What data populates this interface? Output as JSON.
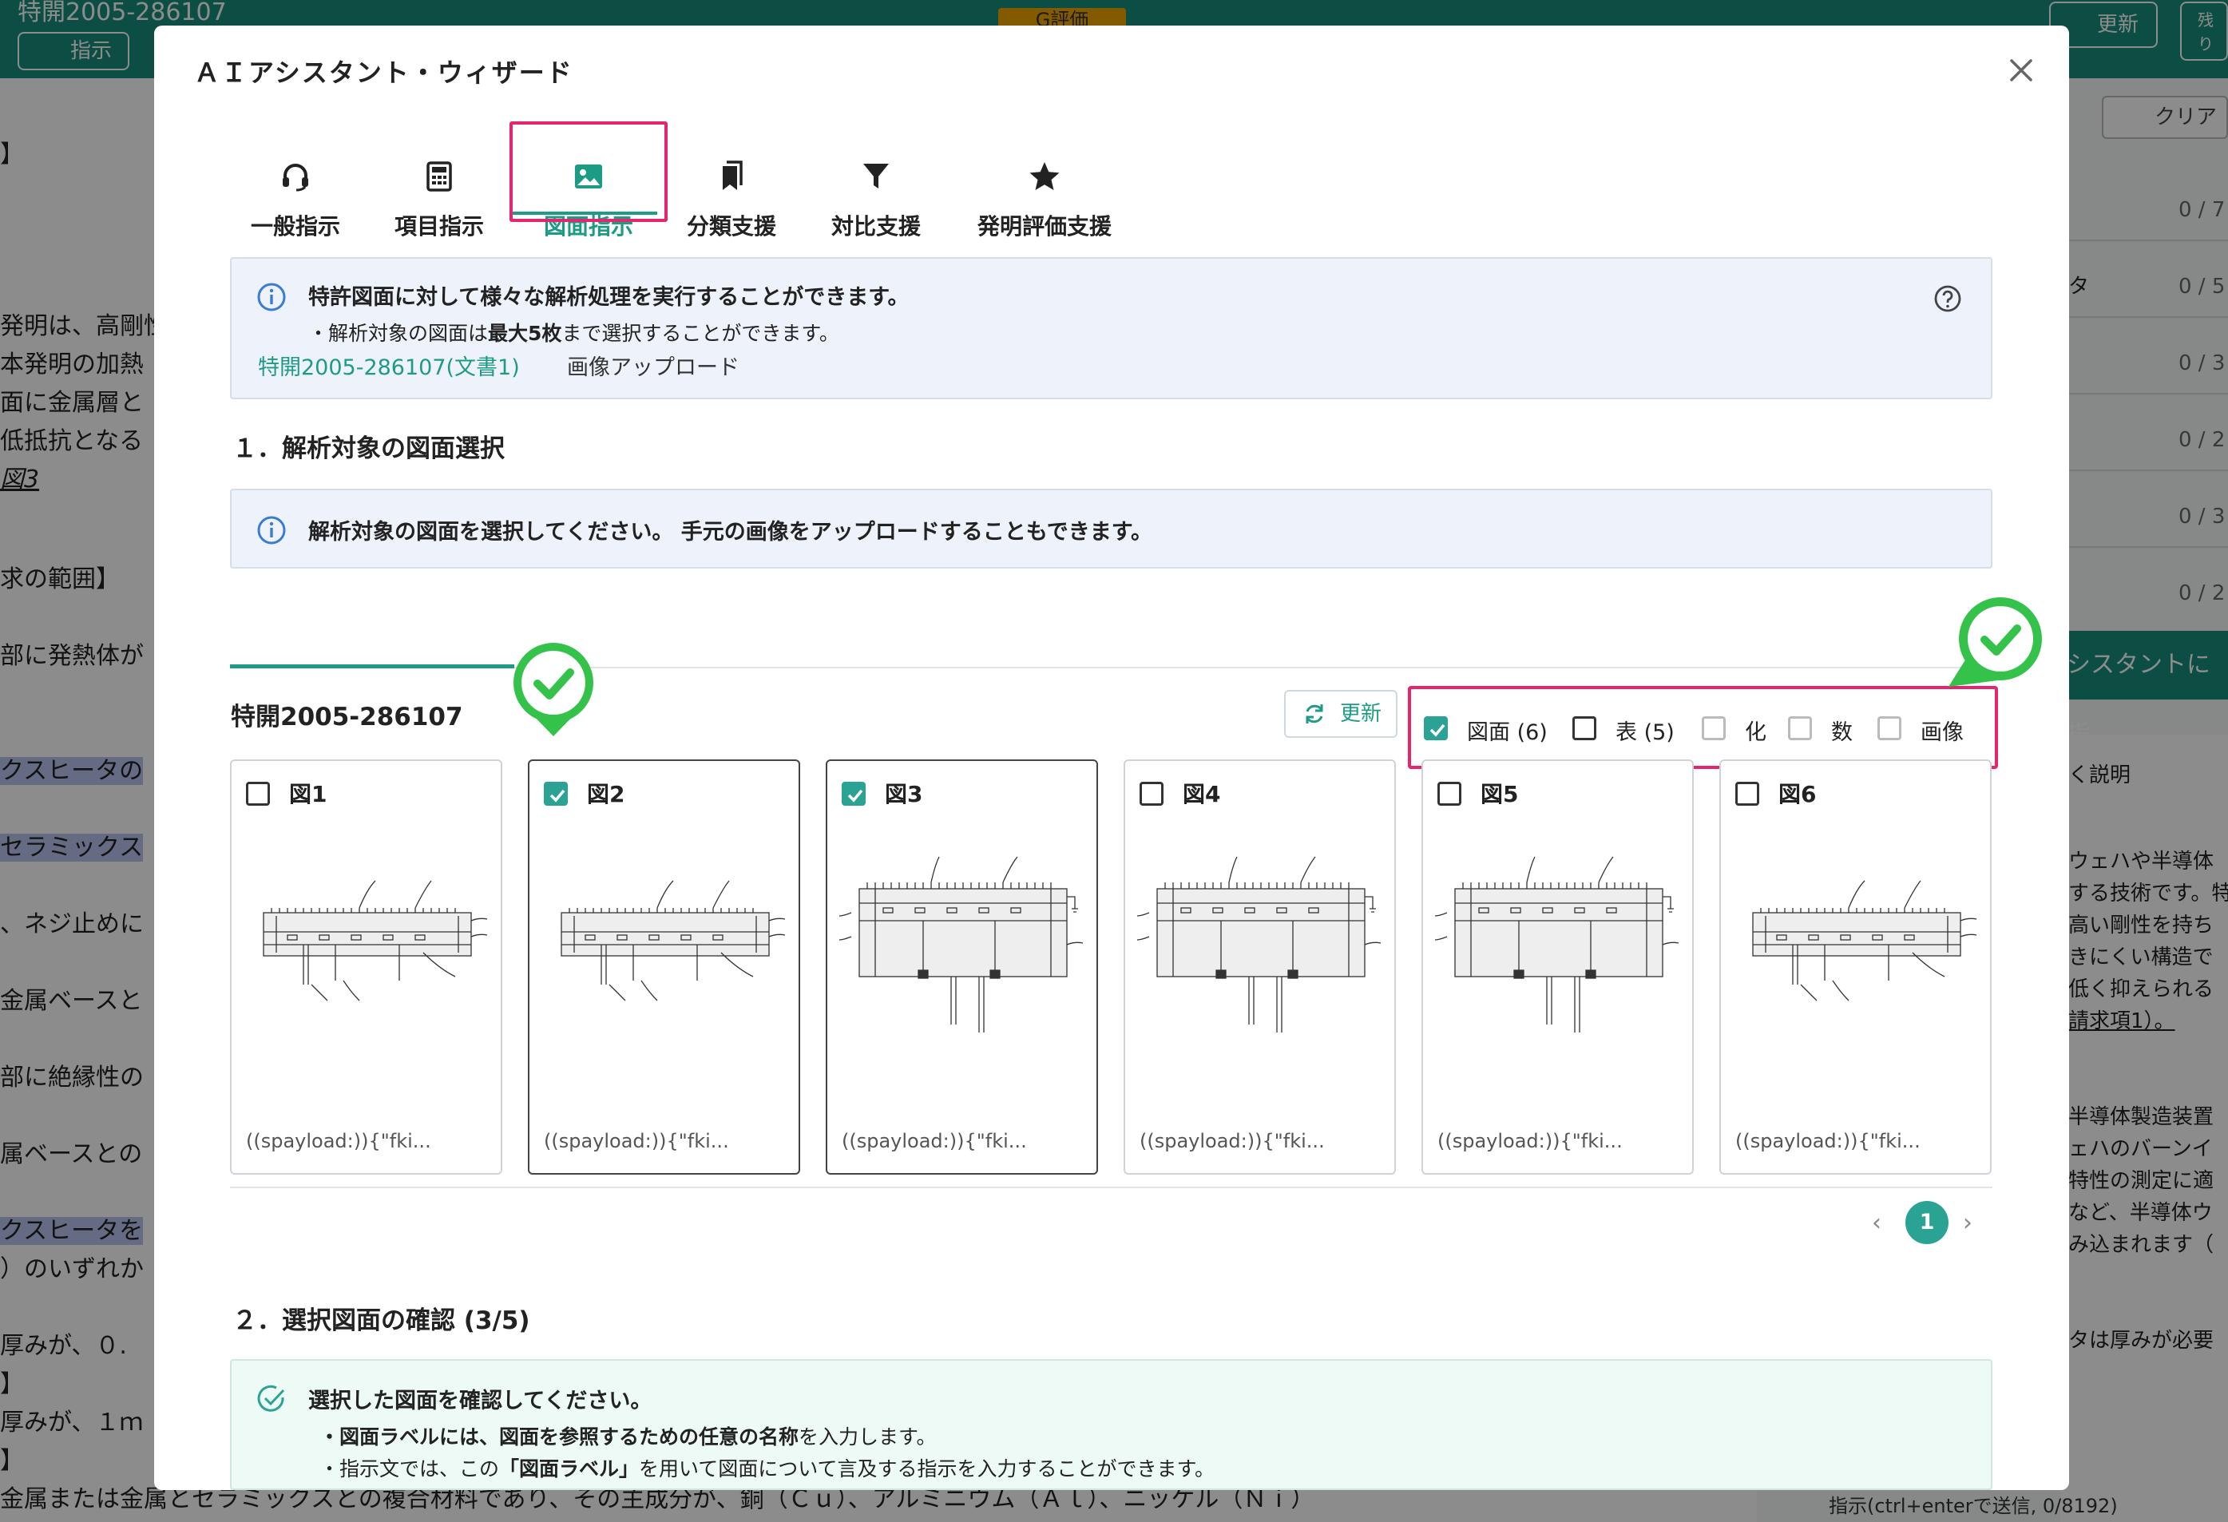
{
  "background": {
    "header_title": "特開2005-286107",
    "instruct_button": "指示",
    "eval_badge": "G評価",
    "update_button": "更新",
    "remain_label": "残り",
    "clear_button": "クリア",
    "doc_lines": [
      "】",
      "発明は、高剛性",
      "本発明の加熱",
      "面に金属層と",
      "低抵抗となる",
      "図3",
      "求の範囲】",
      "部に発熱体が",
      "クスヒータの",
      "セラミックス",
      "、ネジ止めに",
      "金属ベースと",
      "部に絶縁性の",
      "属ベースとの",
      "クスヒータを",
      "）のいずれか",
      "厚みが、０.",
      "】",
      "厚みが、１ｍ",
      "】",
      "金属または金属とセラミックスとの複合材料であり、その主成分が、銅（Ｃｕ）、アルミニウム（Ａｌ）、ニッケル（Ｎｉ）"
    ],
    "right_counts": [
      "0 / 7",
      "0 / 5",
      "0 / 3",
      "0 / 2",
      "0 / 3",
      "0 / 2"
    ],
    "right_label_1": "タ",
    "assistant_button": "シスタントに指",
    "panel_title": "く説明",
    "panel_lines": [
      "ウェハや半導体",
      "する技術です。特",
      "高い剛性を持ち",
      "きにくい構造で",
      "低く抑えられる",
      "請求項1）。",
      "",
      "半導体製造装置",
      "ェハのバーンイ",
      "特性の測定に適",
      "など、半導体ウ",
      "み込まれます（",
      "",
      "",
      "タは厚みが必要"
    ],
    "footer_hint": "指示(ctrl+enterで送信, 0/8192)"
  },
  "modal": {
    "title": "ＡＩアシスタント・ウィザード",
    "tabs": [
      {
        "label": "一般指示",
        "icon": "headset-icon"
      },
      {
        "label": "項目指示",
        "icon": "calculator-icon"
      },
      {
        "label": "図面指示",
        "icon": "image-icon",
        "active": true
      },
      {
        "label": "分類支援",
        "icon": "bookmarks-icon"
      },
      {
        "label": "対比支援",
        "icon": "filter-icon"
      },
      {
        "label": "発明評価支援",
        "icon": "star-icon"
      }
    ],
    "info": {
      "line1": "特許図面に対して様々な解析処理を実行することができます。",
      "line2_prefix": "・解析対象の図面は",
      "line2_bold": "最大5枚",
      "line2_suffix": "まで選択することができます。"
    },
    "section1": {
      "title": "１．解析対象の図面選択",
      "info": "解析対象の図面を選択してください。 手元の画像をアップロードすることもできます。",
      "subtabs": [
        "特開2005-286107(文書1)",
        "画像アップロード"
      ],
      "doc_label": "特開2005-286107",
      "refresh_label": "更新",
      "filters": [
        {
          "label": "図面 (6)",
          "checked": true
        },
        {
          "label": "表 (5)",
          "checked": false
        },
        {
          "label": "化",
          "checked": false
        },
        {
          "label": "数",
          "checked": false
        },
        {
          "label": "画像",
          "checked": false
        }
      ],
      "figures": [
        {
          "label": "図1",
          "checked": false,
          "caption": "((spayload:)){\"fki..."
        },
        {
          "label": "図2",
          "checked": true,
          "caption": "((spayload:)){\"fki..."
        },
        {
          "label": "図3",
          "checked": true,
          "caption": "((spayload:)){\"fki..."
        },
        {
          "label": "図4",
          "checked": false,
          "caption": "((spayload:)){\"fki..."
        },
        {
          "label": "図5",
          "checked": false,
          "caption": "((spayload:)){\"fki..."
        },
        {
          "label": "図6",
          "checked": false,
          "caption": "((spayload:)){\"fki..."
        }
      ],
      "page": "1"
    },
    "section2": {
      "title": "２．選択図面の確認 (3/5)",
      "line1": "選択した図面を確認してください。",
      "line2_bold": "・図面ラベルには、図面を参照するための任意の名称",
      "line2_suffix": "を入力します。",
      "line3_prefix": "・指示文では、この",
      "line3_bold": "「図面ラベル」",
      "line3_suffix": "を用いて図面について言及する指示を入力することができます。"
    }
  },
  "colors": {
    "accent": "#1e9b85",
    "highlight": "#e5256f",
    "check": "#2ba394",
    "marker": "#35c24a"
  }
}
